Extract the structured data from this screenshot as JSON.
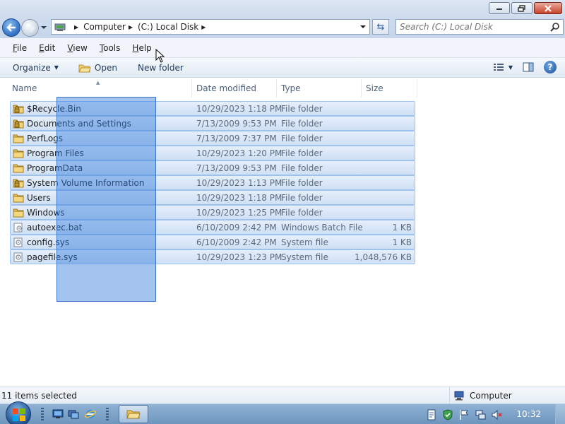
{
  "address": {
    "crumbs": [
      "Computer",
      "(C:) Local Disk"
    ]
  },
  "search": {
    "placeholder": "Search (C:) Local Disk"
  },
  "menu": {
    "items": [
      {
        "label": "File",
        "key": "F",
        "rest": "ile"
      },
      {
        "label": "Edit",
        "key": "E",
        "rest": "dit"
      },
      {
        "label": "View",
        "key": "V",
        "rest": "iew"
      },
      {
        "label": "Tools",
        "key": "T",
        "rest": "ools"
      },
      {
        "label": "Help",
        "key": "H",
        "rest": "elp"
      }
    ]
  },
  "toolbar": {
    "organize": "Organize",
    "open": "Open",
    "new_folder": "New folder"
  },
  "columns": {
    "name": "Name",
    "date": "Date modified",
    "type": "Type",
    "size": "Size"
  },
  "files": [
    {
      "name": "$Recycle.Bin",
      "date": "10/29/2023 1:18 PM",
      "type": "File folder",
      "size": "",
      "icon": "locked-folder-icon"
    },
    {
      "name": "Documents and Settings",
      "date": "7/13/2009 9:53 PM",
      "type": "File folder",
      "size": "",
      "icon": "locked-folder-icon"
    },
    {
      "name": "PerfLogs",
      "date": "7/13/2009 7:37 PM",
      "type": "File folder",
      "size": "",
      "icon": "folder-icon"
    },
    {
      "name": "Program Files",
      "date": "10/29/2023 1:20 PM",
      "type": "File folder",
      "size": "",
      "icon": "folder-icon"
    },
    {
      "name": "ProgramData",
      "date": "7/13/2009 9:53 PM",
      "type": "File folder",
      "size": "",
      "icon": "folder-icon"
    },
    {
      "name": "System Volume Information",
      "date": "10/29/2023 1:13 PM",
      "type": "File folder",
      "size": "",
      "icon": "locked-folder-icon"
    },
    {
      "name": "Users",
      "date": "10/29/2023 1:18 PM",
      "type": "File folder",
      "size": "",
      "icon": "folder-icon"
    },
    {
      "name": "Windows",
      "date": "10/29/2023 1:25 PM",
      "type": "File folder",
      "size": "",
      "icon": "folder-icon"
    },
    {
      "name": "autoexec.bat",
      "date": "6/10/2009 2:42 PM",
      "type": "Windows Batch File",
      "size": "1 KB",
      "icon": "batch-file-icon"
    },
    {
      "name": "config.sys",
      "date": "6/10/2009 2:42 PM",
      "type": "System file",
      "size": "1 KB",
      "icon": "system-file-icon"
    },
    {
      "name": "pagefile.sys",
      "date": "10/29/2023 1:23 PM",
      "type": "System file",
      "size": "1,048,576 KB",
      "icon": "system-file-icon"
    }
  ],
  "status": {
    "selection": "11 items selected",
    "location": "Computer"
  },
  "taskbar": {
    "clock": "10:32"
  },
  "colors": {
    "selection_fill": "#cfe0f5",
    "selection_border": "#9ec2ec",
    "marquee": "#337ddc",
    "taskbar": "#7fa3c9"
  }
}
